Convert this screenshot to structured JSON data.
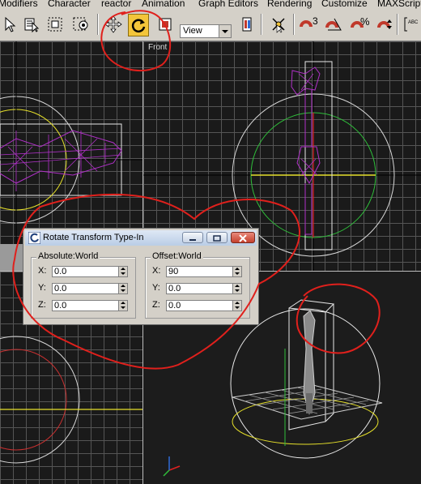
{
  "menu": [
    "Modifiers",
    "Character",
    "reactor",
    "Animation",
    "Graph Editors",
    "Rendering",
    "Customize",
    "MAXScript"
  ],
  "toolbar": {
    "view_dropdown": "View",
    "spinner_snap_number": "3",
    "percent_snap_symbol": "%",
    "active_tool": "rotate",
    "active_color": "#f3c53a"
  },
  "viewports": {
    "front_label": "Front"
  },
  "dialog": {
    "title": "Rotate Transform Type-In",
    "absolute": {
      "title": "Absolute:World",
      "fields": [
        {
          "axis": "X:",
          "value": "0.0"
        },
        {
          "axis": "Y:",
          "value": "0.0"
        },
        {
          "axis": "Z:",
          "value": "0.0"
        }
      ]
    },
    "offset": {
      "title": "Offset:World",
      "fields": [
        {
          "axis": "X:",
          "value": "90"
        },
        {
          "axis": "Y:",
          "value": "0.0"
        },
        {
          "axis": "Z:",
          "value": "0.0"
        }
      ]
    }
  },
  "annotation_color": "#e0201c",
  "wireframe_color": "#b030c8"
}
